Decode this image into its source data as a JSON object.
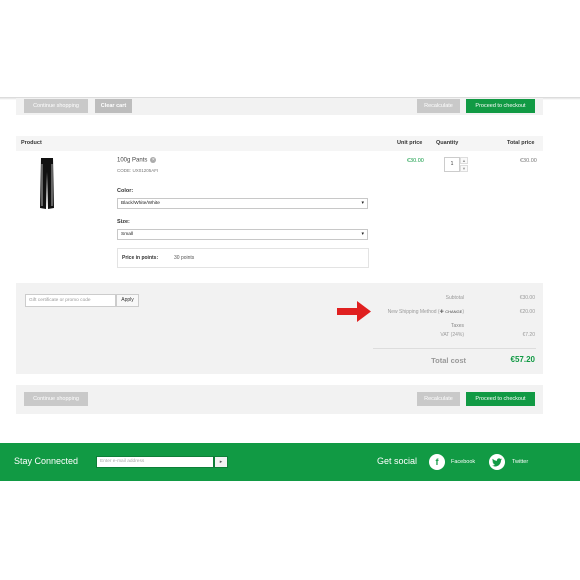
{
  "top_actions": {
    "continue_label": "Continue shopping",
    "clear_label": "Clear cart",
    "recalculate_label": "Recalculate",
    "checkout_label": "Proceed to checkout"
  },
  "cart_header": {
    "product": "Product",
    "unit_price": "Unit price",
    "quantity": "Quantity",
    "total_price": "Total price"
  },
  "item": {
    "name": "100g Pants",
    "code": "CODE: UX01205AFI",
    "color_label": "Color:",
    "color_value": "Black/White/White",
    "size_label": "Size:",
    "size_value": "Small",
    "points_label": "Price in points:",
    "points_value": "30 points",
    "unit_price": "€30.00",
    "quantity": "1",
    "total_price": "€30.00"
  },
  "promo": {
    "placeholder": "Gift certificate or promo code",
    "apply_label": "Apply"
  },
  "summary": {
    "subtotal_label": "Subtotal",
    "subtotal_value": "€30.00",
    "shipping_label": "New Shipping Method (",
    "shipping_change": "CHANGE",
    "shipping_close": ")",
    "shipping_value": "€20.00",
    "taxes_label": "Taxes",
    "vat_label": "VAT (24%)",
    "vat_value": "€7.20",
    "total_label": "Total cost",
    "total_value": "€57.20"
  },
  "bottom_actions": {
    "continue_label": "Continue shopping",
    "recalculate_label": "Recalculate",
    "checkout_label": "Proceed to checkout"
  },
  "footer": {
    "stay_connected": "Stay Connected",
    "email_placeholder": "Enter e-mail address",
    "get_social": "Get social",
    "facebook": "Facebook",
    "twitter": "Twitter"
  },
  "colors": {
    "brand_green": "#119a44",
    "annotation_red": "#e02020"
  },
  "icons": [
    "remove-icon",
    "arrow-annotation-icon",
    "plus-icon",
    "arrow-right-icon",
    "facebook-icon",
    "twitter-icon"
  ]
}
